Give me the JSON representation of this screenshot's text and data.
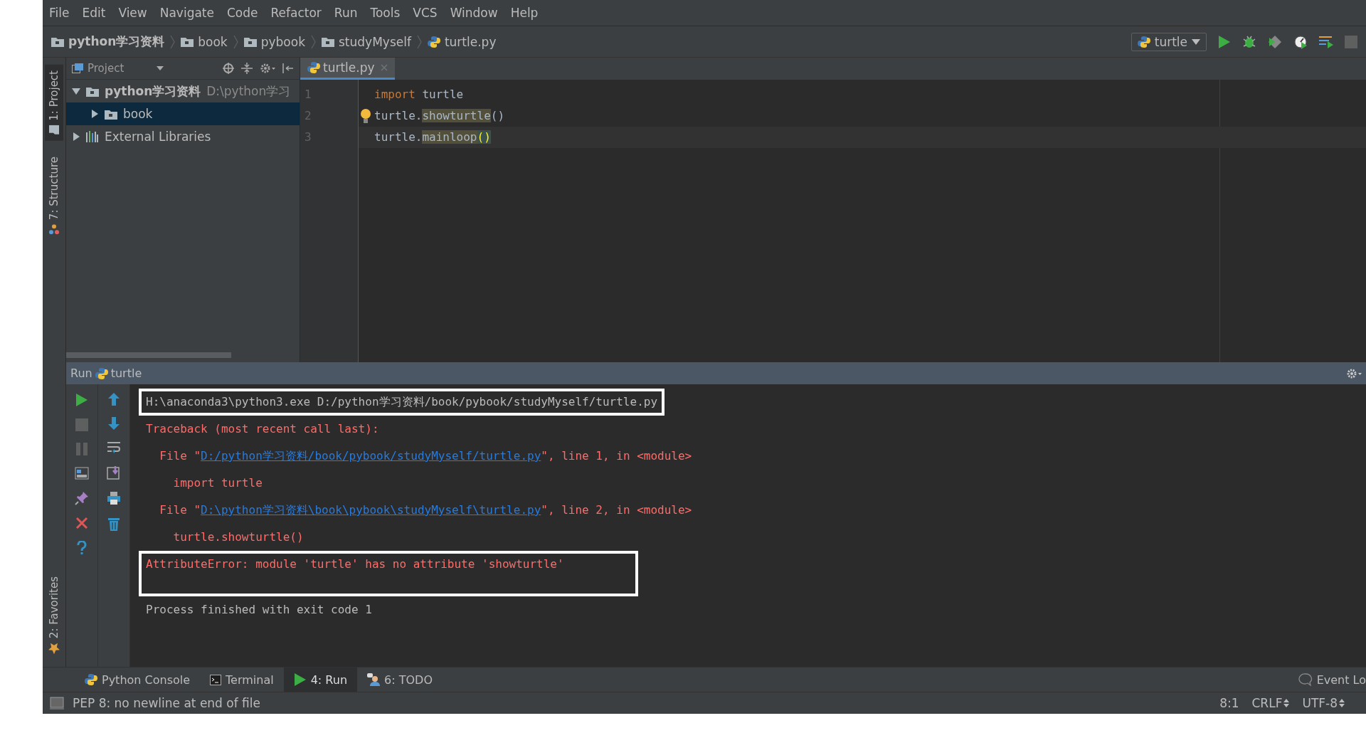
{
  "menu": [
    "File",
    "Edit",
    "View",
    "Navigate",
    "Code",
    "Refactor",
    "Run",
    "Tools",
    "VCS",
    "Window",
    "Help"
  ],
  "breadcrumbs": [
    {
      "label": "python学习资料",
      "kind": "folder",
      "bold": true
    },
    {
      "label": "book",
      "kind": "folder",
      "bold": false
    },
    {
      "label": "pybook",
      "kind": "folder",
      "bold": false
    },
    {
      "label": "studyMyself",
      "kind": "folder",
      "bold": false
    },
    {
      "label": "turtle.py",
      "kind": "python",
      "bold": false
    }
  ],
  "run_config": {
    "label": "turtle"
  },
  "side_tabs_top": [
    {
      "label": "1: Project",
      "selected": true
    },
    {
      "label": "7: Structure",
      "selected": false
    }
  ],
  "side_tabs_bottom": [
    {
      "label": "2: Favorites",
      "selected": false
    }
  ],
  "project_panel": {
    "title": "Project",
    "tree": [
      {
        "label": "python学习资料",
        "path": "D:\\python学习",
        "kind": "folder",
        "bold": true,
        "expanded": true,
        "selected": false,
        "children": [
          {
            "label": "book",
            "kind": "folder",
            "bold": false,
            "expanded": false,
            "selected": true
          }
        ]
      },
      {
        "label": "External Libraries",
        "kind": "library",
        "bold": false,
        "expanded": false,
        "selected": false
      }
    ]
  },
  "editor": {
    "tabs": [
      {
        "label": "turtle.py",
        "selected": true
      }
    ],
    "lines": [
      {
        "number": "1",
        "current": false,
        "bulb": false,
        "tokens": [
          {
            "text": "import",
            "kind": "keyword"
          },
          {
            "text": " turtle",
            "kind": "plain"
          }
        ]
      },
      {
        "number": "2",
        "current": false,
        "bulb": true,
        "tokens": [
          {
            "text": "turtle.",
            "kind": "plain"
          },
          {
            "text": "showturtle",
            "kind": "warning"
          },
          {
            "text": "()",
            "kind": "plain"
          }
        ]
      },
      {
        "number": "3",
        "current": true,
        "bulb": false,
        "tokens": [
          {
            "text": "turtle.",
            "kind": "plain"
          },
          {
            "text": "mainloop",
            "kind": "warning"
          },
          {
            "text": "()",
            "kind": "brace"
          }
        ]
      }
    ]
  },
  "run_panel": {
    "title": "Run",
    "config": "turtle",
    "lines": [
      {
        "boxed": true,
        "segments": [
          {
            "text": "H:\\anaconda3\\python3.exe D:/python学习资料/book/pybook/studyMyself/turtle.py",
            "kind": "plain"
          }
        ]
      },
      {
        "boxed": false,
        "segments": [
          {
            "text": "Traceback (most recent call last):",
            "kind": "error"
          }
        ]
      },
      {
        "boxed": false,
        "segments": [
          {
            "text": "  File \"",
            "kind": "error"
          },
          {
            "text": "D:/python学习资料/book/pybook/studyMyself/turtle.py",
            "kind": "link"
          },
          {
            "text": "\", line 1, in <module>",
            "kind": "error"
          }
        ]
      },
      {
        "boxed": false,
        "segments": [
          {
            "text": "    import turtle",
            "kind": "error"
          }
        ]
      },
      {
        "boxed": false,
        "segments": [
          {
            "text": "  File \"",
            "kind": "error"
          },
          {
            "text": "D:\\python学习资料\\book\\pybook\\studyMyself\\turtle.py",
            "kind": "link"
          },
          {
            "text": "\", line 2, in <module>",
            "kind": "error"
          }
        ]
      },
      {
        "boxed": false,
        "segments": [
          {
            "text": "    turtle.showturtle()",
            "kind": "error"
          }
        ]
      },
      {
        "boxed": true,
        "segments": [
          {
            "text": "AttributeError: module 'turtle' has no attribute 'showturtle'",
            "kind": "error"
          }
        ]
      },
      {
        "boxed": false,
        "segments": [
          {
            "text": "Process finished with exit code 1",
            "kind": "plain"
          }
        ]
      }
    ]
  },
  "bottom_tabs": [
    {
      "label": "Python Console",
      "kind": "python",
      "selected": false
    },
    {
      "label": "Terminal",
      "kind": "terminal",
      "selected": false
    },
    {
      "label": "4: Run",
      "kind": "run",
      "selected": true
    },
    {
      "label": "6: TODO",
      "kind": "todo",
      "selected": false
    }
  ],
  "event_log": "Event Lo",
  "status": {
    "message": "PEP 8: no newline at end of file",
    "position": "8:1",
    "line_separator": "CRLF",
    "encoding": "UTF-8"
  }
}
